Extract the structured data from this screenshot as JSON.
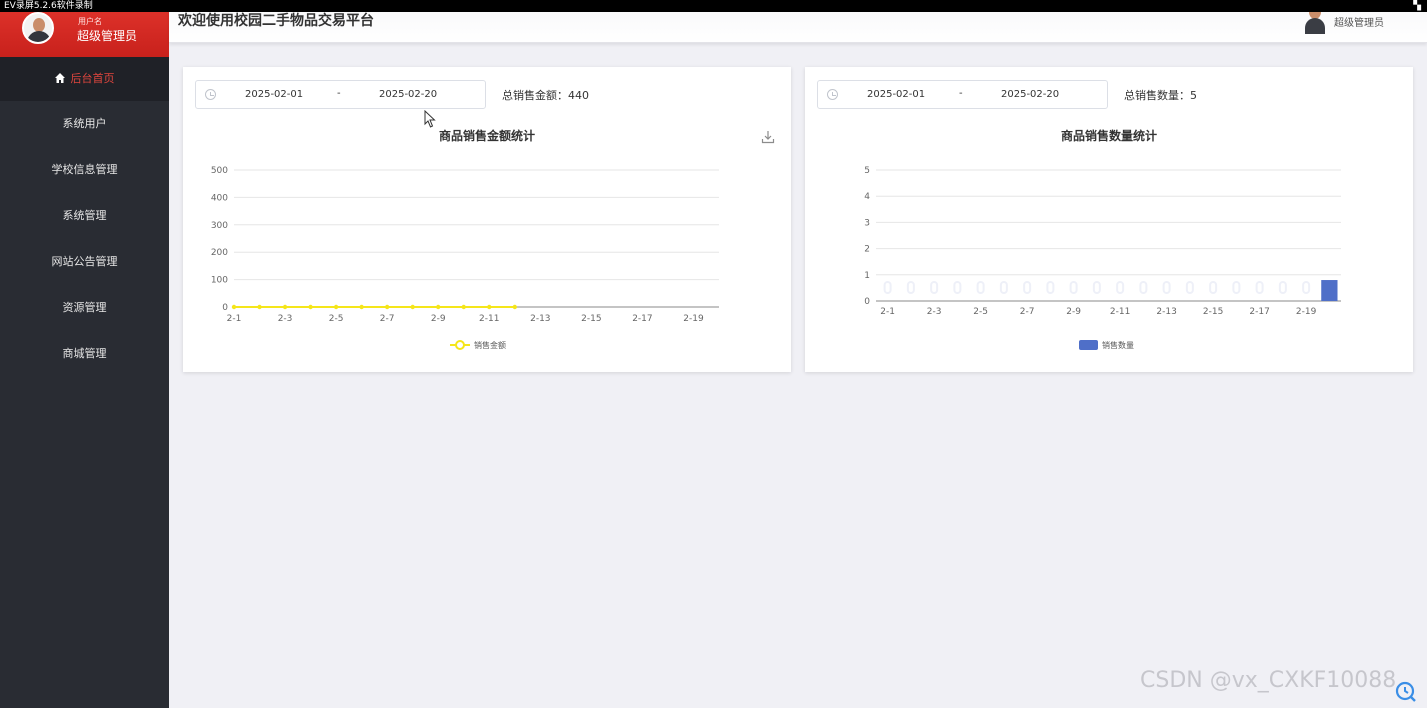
{
  "recorder": {
    "text": "EV录屏5.2.6软件录制"
  },
  "sidebar": {
    "user_label": "用户名",
    "user_name": "超级管理员",
    "menu": [
      {
        "label": "后台首页",
        "icon": "home-icon",
        "active": true
      },
      {
        "label": "系统用户"
      },
      {
        "label": "学校信息管理"
      },
      {
        "label": "系统管理"
      },
      {
        "label": "网站公告管理"
      },
      {
        "label": "资源管理"
      },
      {
        "label": "商城管理"
      }
    ]
  },
  "header": {
    "title": "欢迎使用校园二手物品交易平台",
    "user": "超级管理员"
  },
  "sales_amount_panel": {
    "date_start": "2025-02-01",
    "date_sep": "-",
    "date_end": "2025-02-20",
    "total_text": "总销售金额：440"
  },
  "sales_count_panel": {
    "date_start": "2025-02-01",
    "date_sep": "-",
    "date_end": "2025-02-20",
    "total_text": "总销售数量：5"
  },
  "watermark": "CSDN @vx_CXKF10088",
  "chart_data": [
    {
      "type": "line",
      "title": "商品销售金额统计",
      "x_tick_labels": [
        "2-1",
        "2-3",
        "2-5",
        "2-7",
        "2-9",
        "2-11",
        "2-13",
        "2-15",
        "2-17",
        "2-19"
      ],
      "x": [
        "2-1",
        "2-2",
        "2-3",
        "2-4",
        "2-5",
        "2-6",
        "2-7",
        "2-8",
        "2-9",
        "2-10",
        "2-11",
        "2-12"
      ],
      "series": [
        {
          "name": "销售金额",
          "values": [
            0,
            0,
            0,
            0,
            0,
            0,
            0,
            0,
            0,
            0,
            0,
            0
          ],
          "color": "#f5e61a"
        }
      ],
      "x_range": [
        "2-1",
        "2-20"
      ],
      "yticks": [
        0,
        100,
        200,
        300,
        400,
        500
      ],
      "ylim": [
        0,
        500
      ],
      "grid": true,
      "legend": "bottom-center"
    },
    {
      "type": "bar",
      "title": "商品销售数量统计",
      "x_tick_labels": [
        "2-1",
        "2-3",
        "2-5",
        "2-7",
        "2-9",
        "2-11",
        "2-13",
        "2-15",
        "2-17",
        "2-19"
      ],
      "categories": [
        "2-1",
        "2-2",
        "2-3",
        "2-4",
        "2-5",
        "2-6",
        "2-7",
        "2-8",
        "2-9",
        "2-10",
        "2-11",
        "2-12",
        "2-13",
        "2-14",
        "2-15",
        "2-16",
        "2-17",
        "2-18",
        "2-19",
        "2-20"
      ],
      "series": [
        {
          "name": "销售数量",
          "values": [
            0,
            0,
            0,
            0,
            0,
            0,
            0,
            0,
            0,
            0,
            0,
            0,
            0,
            0,
            0,
            0,
            0,
            0,
            0,
            0.8
          ],
          "color": "#4f6fc8",
          "background_bar_color": "#eef0f8"
        }
      ],
      "yticks": [
        0,
        1,
        2,
        3,
        4,
        5
      ],
      "ylim": [
        0,
        5
      ],
      "grid": true,
      "legend": "bottom-center"
    }
  ]
}
